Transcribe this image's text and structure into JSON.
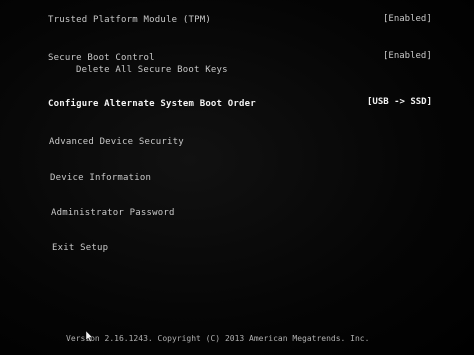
{
  "menu": {
    "items": [
      {
        "label": "Trusted Platform Module (TPM)",
        "value": "[Enabled]"
      },
      {
        "label": "Secure Boot Control",
        "value": "[Enabled]"
      },
      {
        "label": "Delete All Secure Boot Keys"
      },
      {
        "label": "Configure Alternate System Boot Order",
        "value": "[USB -> SSD]"
      },
      {
        "label": "Advanced Device Security"
      },
      {
        "label": "Device Information"
      },
      {
        "label": "Administrator Password"
      },
      {
        "label": "Exit Setup"
      }
    ]
  },
  "footer": {
    "text": "Version 2.16.1243. Copyright (C) 2013 American Megatrends. Inc."
  },
  "colors": {
    "background": "#000000",
    "text": "#c9c9c9",
    "highlight": "#f3f3f3"
  }
}
